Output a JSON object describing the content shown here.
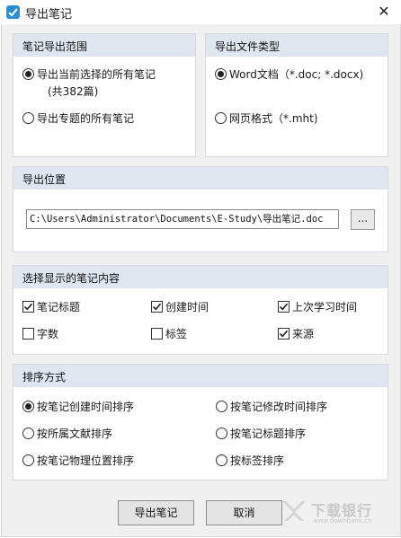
{
  "window": {
    "title": "导出笔记",
    "close_glyph": "✕"
  },
  "range_group": {
    "title": "笔记导出范围",
    "options": [
      {
        "label": "导出当前选择的所有笔记",
        "sub": "(共382篇)",
        "checked": true
      },
      {
        "label": "导出专题的所有笔记",
        "checked": false
      }
    ]
  },
  "type_group": {
    "title": "导出文件类型",
    "options": [
      {
        "label": "Word文档（*.doc; *.docx)",
        "checked": true
      },
      {
        "label": "网页格式（*.mht)",
        "checked": false
      }
    ]
  },
  "location_group": {
    "title": "导出位置",
    "path": "C:\\Users\\Administrator\\Documents\\E-Study\\导出笔记.doc",
    "browse_label": "..."
  },
  "content_group": {
    "title": "选择显示的笔记内容",
    "items": [
      {
        "label": "笔记标题",
        "checked": true
      },
      {
        "label": "创建时间",
        "checked": true
      },
      {
        "label": "上次学习时间",
        "checked": true
      },
      {
        "label": "字数",
        "checked": false
      },
      {
        "label": "标签",
        "checked": false
      },
      {
        "label": "来源",
        "checked": true
      }
    ]
  },
  "sort_group": {
    "title": "排序方式",
    "options": [
      {
        "label": "按笔记创建时间排序",
        "checked": true
      },
      {
        "label": "按笔记修改时间排序",
        "checked": false
      },
      {
        "label": "按所属文献排序",
        "checked": false
      },
      {
        "label": "按笔记标题排序",
        "checked": false
      },
      {
        "label": "按笔记物理位置排序",
        "checked": false
      },
      {
        "label": "按标签排序",
        "checked": false
      }
    ]
  },
  "buttons": {
    "export": "导出笔记",
    "cancel": "取消"
  },
  "watermark": {
    "text": "下载银行",
    "url": "www.downbank.cn"
  },
  "colors": {
    "header": "#dfe6ef",
    "client": "#f0f0f0",
    "icon": "#2b8fd6"
  }
}
